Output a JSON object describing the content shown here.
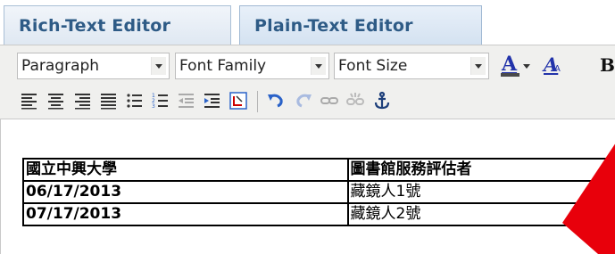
{
  "tabs": {
    "rich": "Rich-Text Editor",
    "plain": "Plain-Text Editor"
  },
  "toolbar": {
    "format_select": "Paragraph",
    "font_family_select": "Font Family",
    "font_size_select": "Font Size",
    "text_color_label": "A",
    "text_color_accent": "#4a4a4a",
    "clear_format_label": "A",
    "bold_label": "B"
  },
  "icons": [
    "align-left-icon",
    "align-center-icon",
    "align-right-icon",
    "align-justify-icon",
    "bullet-list-icon",
    "numbered-list-icon",
    "outdent-icon",
    "indent-icon",
    "paste-word-icon",
    "undo-icon",
    "redo-icon",
    "link-icon",
    "unlink-icon",
    "anchor-icon"
  ],
  "table": {
    "headers": [
      "國立中興大學",
      "圖書館服務評估者"
    ],
    "rows": [
      [
        "06/17/2013",
        "藏鏡人1號"
      ],
      [
        "07/17/2013",
        "藏鏡人2號"
      ]
    ]
  },
  "colors": {
    "tab_text": "#2e5b86",
    "toolbar_bg": "#f0f0ee",
    "pointer_arrow": "#e8000b"
  }
}
